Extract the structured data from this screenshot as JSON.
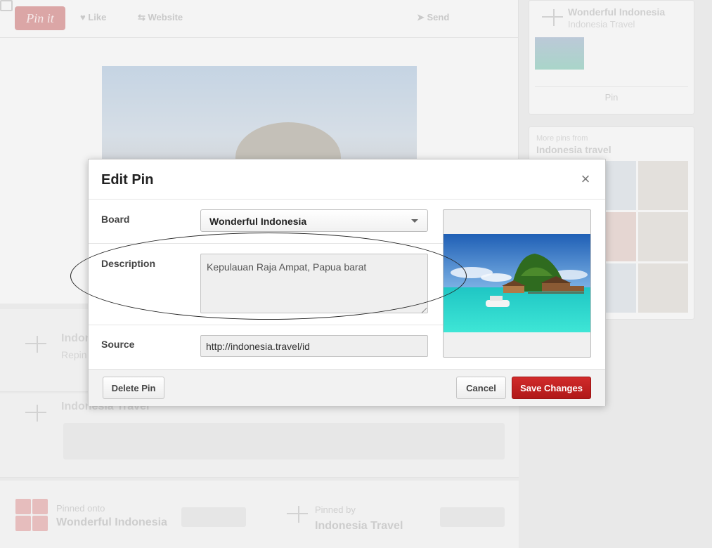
{
  "background": {
    "toolbar": {
      "pin_it": "Pin it",
      "like": "Like",
      "website": "Website",
      "send": "Send"
    },
    "sidebar_board": {
      "title": "Wonderful Indonesia",
      "subtitle": "Indonesia Travel",
      "button": "Pin"
    },
    "sidebar_more": {
      "top": "More pins from",
      "title": "Indonesia travel"
    },
    "pinner_rows": [
      {
        "name": "Indon",
        "sub": "Repin"
      },
      {
        "name": "Indonesia Travel"
      }
    ],
    "footer": {
      "pinned_onto_label": "Pinned onto",
      "pinned_onto_value": "Wonderful Indonesia",
      "pinned_by_label": "Pinned by",
      "pinned_by_value": "Indonesia Travel"
    }
  },
  "modal": {
    "title": "Edit Pin",
    "close_glyph": "×",
    "board": {
      "label": "Board",
      "value": "Wonderful Indonesia"
    },
    "description": {
      "label": "Description",
      "value": "Kepulauan Raja Ampat, Papua barat"
    },
    "source": {
      "label": "Source",
      "value": "http://indonesia.travel/id"
    },
    "buttons": {
      "delete": "Delete Pin",
      "cancel": "Cancel",
      "save": "Save Changes"
    }
  },
  "colors": {
    "accent_red": "#b81c1c",
    "modal_bg": "#ffffff",
    "footer_bg": "#f2f2f2",
    "annotation": "#222222"
  },
  "icons": [
    "heart-icon",
    "website-icon",
    "send-icon",
    "share-icon",
    "close-icon",
    "chevron-down-icon"
  ]
}
